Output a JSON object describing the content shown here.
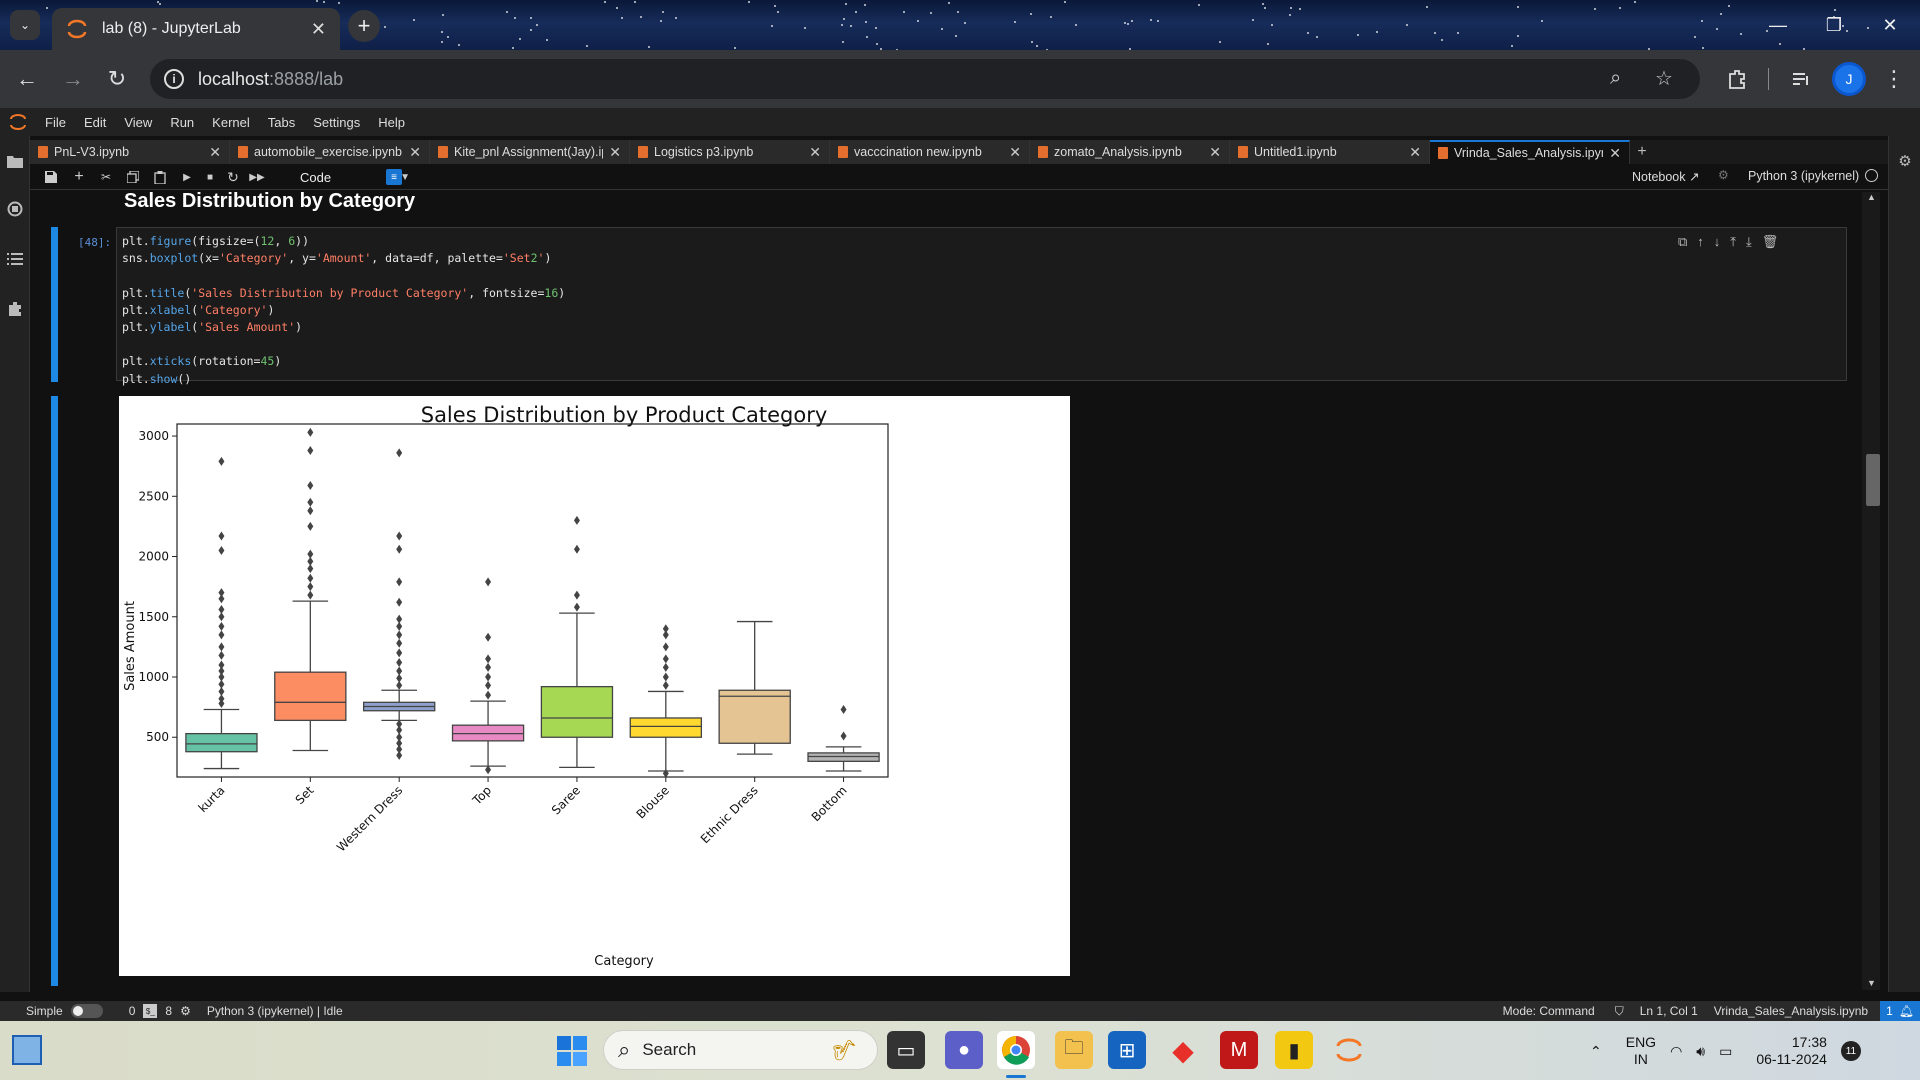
{
  "browser": {
    "tab_title": "lab (8) - JupyterLab",
    "url_host": "localhost",
    "url_path": ":8888/lab",
    "avatar_letter": "J"
  },
  "jupyter": {
    "menu": [
      "File",
      "Edit",
      "View",
      "Run",
      "Kernel",
      "Tabs",
      "Settings",
      "Help"
    ],
    "tabs": [
      {
        "label": "PnL-V3.ipynb"
      },
      {
        "label": "automobile_exercise.ipynb"
      },
      {
        "label": "Kite_pnl Assignment(Jay).ipynb"
      },
      {
        "label": "Logistics p3.ipynb"
      },
      {
        "label": "vacccination new.ipynb"
      },
      {
        "label": "zomato_Analysis.ipynb"
      },
      {
        "label": "Untitled1.ipynb"
      },
      {
        "label": "Vrinda_Sales_Analysis.ipynb"
      }
    ],
    "cell_type": "Code",
    "notebook_label": "Notebook",
    "kernel_label": "Python 3 (ipykernel)",
    "heading": "Sales Distribution by Category",
    "prompt": "[48]:",
    "code_lines": [
      "plt.figure(figsize=(12, 6))",
      "sns.boxplot(x='Category', y='Amount', data=df, palette='Set2')",
      "",
      "plt.title('Sales Distribution by Product Category', fontsize=16)",
      "plt.xlabel('Category')",
      "plt.ylabel('Sales Amount')",
      "",
      "plt.xticks(rotation=45)",
      "plt.show()"
    ]
  },
  "chart_data": {
    "type": "box",
    "title": "Sales Distribution by Product Category",
    "xlabel": "Category",
    "ylabel": "Sales Amount",
    "ylim": [
      170,
      3100
    ],
    "yticks": [
      500,
      1000,
      1500,
      2000,
      2500,
      3000
    ],
    "categories": [
      "kurta",
      "Set",
      "Western Dress",
      "Top",
      "Saree",
      "Blouse",
      "Ethnic Dress",
      "Bottom"
    ],
    "colors": [
      "#66c2a5",
      "#fc8d62",
      "#8da0cb",
      "#e78ac3",
      "#a6d854",
      "#ffd92f",
      "#e5c494",
      "#b3b3b3"
    ],
    "boxes": [
      {
        "whislo": 240,
        "q1": 380,
        "med": 445,
        "q3": 530,
        "whishi": 730,
        "fliers": [
          780,
          820,
          880,
          940,
          1000,
          1050,
          1100,
          1180,
          1250,
          1350,
          1420,
          1500,
          1560,
          1650,
          1700,
          2050,
          2170,
          2790
        ]
      },
      {
        "whislo": 390,
        "q1": 640,
        "med": 790,
        "q3": 1040,
        "whishi": 1630,
        "fliers": [
          1680,
          1750,
          1820,
          1900,
          1960,
          2020,
          2250,
          2380,
          2450,
          2590,
          2880,
          3030
        ]
      },
      {
        "whislo": 640,
        "q1": 720,
        "med": 755,
        "q3": 790,
        "whishi": 890,
        "fliers": [
          350,
          400,
          450,
          500,
          560,
          610,
          930,
          990,
          1050,
          1120,
          1200,
          1280,
          1350,
          1420,
          1480,
          1620,
          1790,
          2060,
          2170,
          2860
        ]
      },
      {
        "whislo": 260,
        "q1": 470,
        "med": 530,
        "q3": 600,
        "whishi": 800,
        "fliers": [
          230,
          850,
          930,
          1000,
          1080,
          1150,
          1330,
          1790
        ]
      },
      {
        "whislo": 250,
        "q1": 500,
        "med": 660,
        "q3": 920,
        "whishi": 1530,
        "fliers": [
          1580,
          1680,
          2060,
          2300
        ]
      },
      {
        "whislo": 220,
        "q1": 500,
        "med": 590,
        "q3": 660,
        "whishi": 880,
        "fliers": [
          200,
          930,
          1000,
          1080,
          1150,
          1250,
          1350,
          1400
        ]
      },
      {
        "whislo": 360,
        "q1": 450,
        "med": 840,
        "q3": 890,
        "whishi": 1460,
        "fliers": []
      },
      {
        "whislo": 220,
        "q1": 300,
        "med": 340,
        "q3": 370,
        "whishi": 420,
        "fliers": [
          510,
          730
        ]
      }
    ]
  },
  "statusbar": {
    "mode_label": "Simple",
    "count_a": "0",
    "count_b": "8",
    "kernel_status": "Python 3 (ipykernel) | Idle",
    "mode": "Mode: Command",
    "position": "Ln 1, Col 1",
    "file": "Vrinda_Sales_Analysis.ipynb",
    "notif": "1"
  },
  "taskbar": {
    "search_placeholder": "Search",
    "lang_line1": "ENG",
    "lang_line2": "IN",
    "time": "17:38",
    "date": "06-11-2024",
    "notif_count": "11"
  }
}
